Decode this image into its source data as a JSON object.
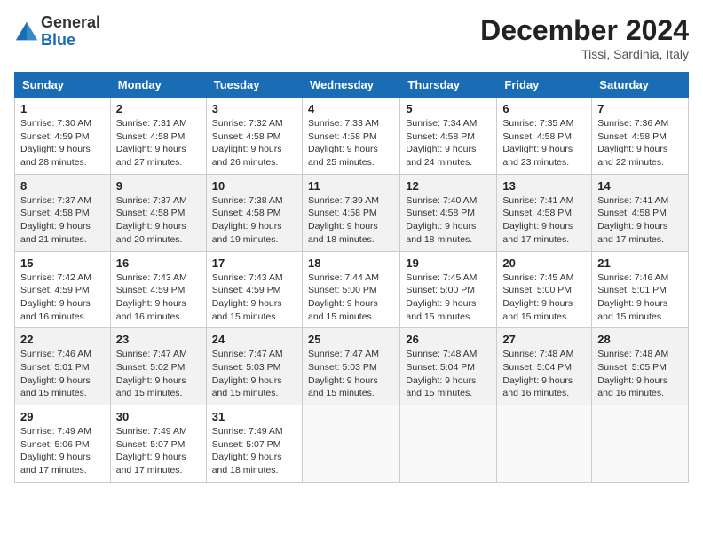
{
  "header": {
    "logo": {
      "general": "General",
      "blue": "Blue"
    },
    "month": "December 2024",
    "location": "Tissi, Sardinia, Italy"
  },
  "weekdays": [
    "Sunday",
    "Monday",
    "Tuesday",
    "Wednesday",
    "Thursday",
    "Friday",
    "Saturday"
  ],
  "weeks": [
    [
      {
        "day": "1",
        "sunrise": "Sunrise: 7:30 AM",
        "sunset": "Sunset: 4:59 PM",
        "daylight": "Daylight: 9 hours and 28 minutes."
      },
      {
        "day": "2",
        "sunrise": "Sunrise: 7:31 AM",
        "sunset": "Sunset: 4:58 PM",
        "daylight": "Daylight: 9 hours and 27 minutes."
      },
      {
        "day": "3",
        "sunrise": "Sunrise: 7:32 AM",
        "sunset": "Sunset: 4:58 PM",
        "daylight": "Daylight: 9 hours and 26 minutes."
      },
      {
        "day": "4",
        "sunrise": "Sunrise: 7:33 AM",
        "sunset": "Sunset: 4:58 PM",
        "daylight": "Daylight: 9 hours and 25 minutes."
      },
      {
        "day": "5",
        "sunrise": "Sunrise: 7:34 AM",
        "sunset": "Sunset: 4:58 PM",
        "daylight": "Daylight: 9 hours and 24 minutes."
      },
      {
        "day": "6",
        "sunrise": "Sunrise: 7:35 AM",
        "sunset": "Sunset: 4:58 PM",
        "daylight": "Daylight: 9 hours and 23 minutes."
      },
      {
        "day": "7",
        "sunrise": "Sunrise: 7:36 AM",
        "sunset": "Sunset: 4:58 PM",
        "daylight": "Daylight: 9 hours and 22 minutes."
      }
    ],
    [
      {
        "day": "8",
        "sunrise": "Sunrise: 7:37 AM",
        "sunset": "Sunset: 4:58 PM",
        "daylight": "Daylight: 9 hours and 21 minutes."
      },
      {
        "day": "9",
        "sunrise": "Sunrise: 7:37 AM",
        "sunset": "Sunset: 4:58 PM",
        "daylight": "Daylight: 9 hours and 20 minutes."
      },
      {
        "day": "10",
        "sunrise": "Sunrise: 7:38 AM",
        "sunset": "Sunset: 4:58 PM",
        "daylight": "Daylight: 9 hours and 19 minutes."
      },
      {
        "day": "11",
        "sunrise": "Sunrise: 7:39 AM",
        "sunset": "Sunset: 4:58 PM",
        "daylight": "Daylight: 9 hours and 18 minutes."
      },
      {
        "day": "12",
        "sunrise": "Sunrise: 7:40 AM",
        "sunset": "Sunset: 4:58 PM",
        "daylight": "Daylight: 9 hours and 18 minutes."
      },
      {
        "day": "13",
        "sunrise": "Sunrise: 7:41 AM",
        "sunset": "Sunset: 4:58 PM",
        "daylight": "Daylight: 9 hours and 17 minutes."
      },
      {
        "day": "14",
        "sunrise": "Sunrise: 7:41 AM",
        "sunset": "Sunset: 4:58 PM",
        "daylight": "Daylight: 9 hours and 17 minutes."
      }
    ],
    [
      {
        "day": "15",
        "sunrise": "Sunrise: 7:42 AM",
        "sunset": "Sunset: 4:59 PM",
        "daylight": "Daylight: 9 hours and 16 minutes."
      },
      {
        "day": "16",
        "sunrise": "Sunrise: 7:43 AM",
        "sunset": "Sunset: 4:59 PM",
        "daylight": "Daylight: 9 hours and 16 minutes."
      },
      {
        "day": "17",
        "sunrise": "Sunrise: 7:43 AM",
        "sunset": "Sunset: 4:59 PM",
        "daylight": "Daylight: 9 hours and 15 minutes."
      },
      {
        "day": "18",
        "sunrise": "Sunrise: 7:44 AM",
        "sunset": "Sunset: 5:00 PM",
        "daylight": "Daylight: 9 hours and 15 minutes."
      },
      {
        "day": "19",
        "sunrise": "Sunrise: 7:45 AM",
        "sunset": "Sunset: 5:00 PM",
        "daylight": "Daylight: 9 hours and 15 minutes."
      },
      {
        "day": "20",
        "sunrise": "Sunrise: 7:45 AM",
        "sunset": "Sunset: 5:00 PM",
        "daylight": "Daylight: 9 hours and 15 minutes."
      },
      {
        "day": "21",
        "sunrise": "Sunrise: 7:46 AM",
        "sunset": "Sunset: 5:01 PM",
        "daylight": "Daylight: 9 hours and 15 minutes."
      }
    ],
    [
      {
        "day": "22",
        "sunrise": "Sunrise: 7:46 AM",
        "sunset": "Sunset: 5:01 PM",
        "daylight": "Daylight: 9 hours and 15 minutes."
      },
      {
        "day": "23",
        "sunrise": "Sunrise: 7:47 AM",
        "sunset": "Sunset: 5:02 PM",
        "daylight": "Daylight: 9 hours and 15 minutes."
      },
      {
        "day": "24",
        "sunrise": "Sunrise: 7:47 AM",
        "sunset": "Sunset: 5:03 PM",
        "daylight": "Daylight: 9 hours and 15 minutes."
      },
      {
        "day": "25",
        "sunrise": "Sunrise: 7:47 AM",
        "sunset": "Sunset: 5:03 PM",
        "daylight": "Daylight: 9 hours and 15 minutes."
      },
      {
        "day": "26",
        "sunrise": "Sunrise: 7:48 AM",
        "sunset": "Sunset: 5:04 PM",
        "daylight": "Daylight: 9 hours and 15 minutes."
      },
      {
        "day": "27",
        "sunrise": "Sunrise: 7:48 AM",
        "sunset": "Sunset: 5:04 PM",
        "daylight": "Daylight: 9 hours and 16 minutes."
      },
      {
        "day": "28",
        "sunrise": "Sunrise: 7:48 AM",
        "sunset": "Sunset: 5:05 PM",
        "daylight": "Daylight: 9 hours and 16 minutes."
      }
    ],
    [
      {
        "day": "29",
        "sunrise": "Sunrise: 7:49 AM",
        "sunset": "Sunset: 5:06 PM",
        "daylight": "Daylight: 9 hours and 17 minutes."
      },
      {
        "day": "30",
        "sunrise": "Sunrise: 7:49 AM",
        "sunset": "Sunset: 5:07 PM",
        "daylight": "Daylight: 9 hours and 17 minutes."
      },
      {
        "day": "31",
        "sunrise": "Sunrise: 7:49 AM",
        "sunset": "Sunset: 5:07 PM",
        "daylight": "Daylight: 9 hours and 18 minutes."
      },
      null,
      null,
      null,
      null
    ]
  ]
}
